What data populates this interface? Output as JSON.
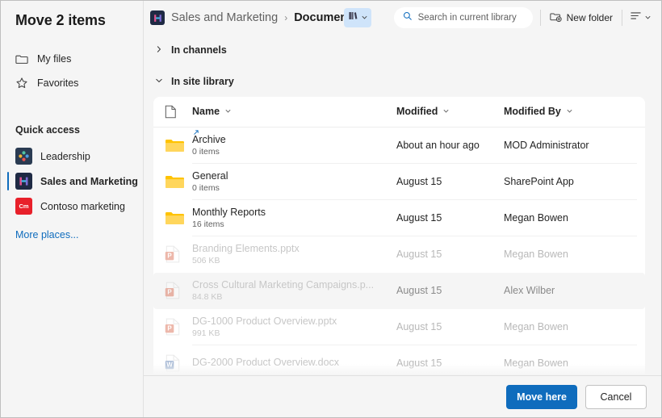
{
  "dialog": {
    "title": "Move 2 items"
  },
  "sidebar": {
    "nav": [
      {
        "label": "My files",
        "icon": "folder-icon"
      },
      {
        "label": "Favorites",
        "icon": "star-icon"
      }
    ],
    "quick_access_heading": "Quick access",
    "quick_access": [
      {
        "label": "Leadership",
        "icon": "leadership-site-icon",
        "selected": false
      },
      {
        "label": "Sales and Marketing",
        "icon": "sales-marketing-site-icon",
        "selected": true
      },
      {
        "label": "Contoso marketing",
        "icon": "contoso-marketing-site-icon",
        "badge": "Cm",
        "selected": false
      }
    ],
    "more_places": "More places..."
  },
  "commandbar": {
    "breadcrumb": {
      "site": "Sales and Marketing",
      "separator": "›",
      "current": "Documents"
    },
    "library_switcher": {
      "icon": "library-books-icon",
      "chevron": "chevron-down-icon"
    },
    "search": {
      "placeholder": "Search in current library",
      "icon": "search-icon"
    },
    "new_folder": {
      "label": "New folder",
      "icon": "new-folder-icon"
    },
    "view_options": {
      "icon": "list-view-icon",
      "chevron": "chevron-down-icon"
    }
  },
  "sections": {
    "channels": {
      "label": "In channels",
      "expanded": false,
      "chevron": "chevron-right-icon"
    },
    "site_library": {
      "label": "In site library",
      "expanded": true,
      "chevron": "chevron-down-icon"
    }
  },
  "table": {
    "columns": [
      {
        "key": "icon",
        "label": "",
        "icon": "file-type-icon"
      },
      {
        "key": "name",
        "label": "Name",
        "sort_icon": "chevron-down-icon"
      },
      {
        "key": "modified",
        "label": "Modified",
        "sort_icon": "chevron-down-icon"
      },
      {
        "key": "modified_by",
        "label": "Modified By",
        "sort_icon": "chevron-down-icon"
      }
    ],
    "rows": [
      {
        "name": "Archive",
        "sub": "0 items",
        "modified": "About an hour ago",
        "modified_by": "MOD Administrator",
        "type": "folder",
        "shortcut": true,
        "dim": false,
        "highlight": false
      },
      {
        "name": "General",
        "sub": "0 items",
        "modified": "August 15",
        "modified_by": "SharePoint App",
        "type": "folder",
        "shortcut": false,
        "dim": false,
        "highlight": false
      },
      {
        "name": "Monthly Reports",
        "sub": "16 items",
        "modified": "August 15",
        "modified_by": "Megan Bowen",
        "type": "folder",
        "shortcut": false,
        "dim": false,
        "highlight": false
      },
      {
        "name": "Branding Elements.pptx",
        "sub": "506 KB",
        "modified": "August 15",
        "modified_by": "Megan Bowen",
        "type": "pptx",
        "shortcut": false,
        "dim": true,
        "highlight": false
      },
      {
        "name": "Cross Cultural Marketing Campaigns.p...",
        "sub": "84.8 KB",
        "modified": "August 15",
        "modified_by": "Alex Wilber",
        "type": "pptx",
        "shortcut": false,
        "dim": true,
        "highlight": true
      },
      {
        "name": "DG-1000 Product Overview.pptx",
        "sub": "991 KB",
        "modified": "August 15",
        "modified_by": "Megan Bowen",
        "type": "pptx",
        "shortcut": false,
        "dim": true,
        "highlight": false
      },
      {
        "name": "DG-2000 Product Overview.docx",
        "sub": "",
        "modified": "August 15",
        "modified_by": "Megan Bowen",
        "type": "docx",
        "shortcut": false,
        "dim": true,
        "highlight": false
      }
    ]
  },
  "footer": {
    "primary": "Move here",
    "secondary": "Cancel"
  },
  "colors": {
    "accent": "#0f6cbd",
    "folder": "#ffc300",
    "powerpoint": "#d24726",
    "word": "#2b579a",
    "surface": "#f5f5f5",
    "card": "#ffffff"
  }
}
